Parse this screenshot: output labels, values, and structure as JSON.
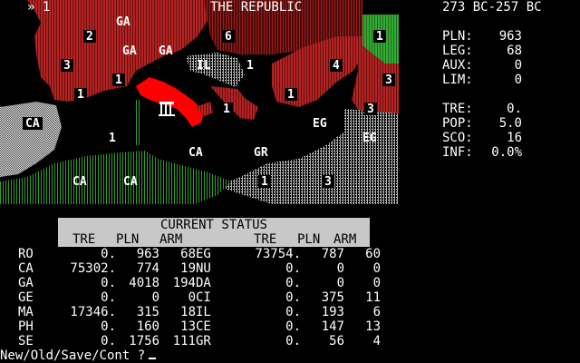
{
  "map": {
    "title": "THE REPUBLIC",
    "corner_label": "» 1",
    "labels": [
      {
        "t": "GA"
      },
      {
        "t": "2"
      },
      {
        "t": "GA"
      },
      {
        "t": "GA"
      },
      {
        "t": "6"
      },
      {
        "t": "1"
      },
      {
        "t": "3"
      },
      {
        "t": "1"
      },
      {
        "t": "IL"
      },
      {
        "t": "1"
      },
      {
        "t": "4"
      },
      {
        "t": "3"
      },
      {
        "t": "1"
      },
      {
        "t": "1"
      },
      {
        "t": "1"
      },
      {
        "t": "CA"
      },
      {
        "t": "EG"
      },
      {
        "t": "3"
      },
      {
        "t": "1"
      },
      {
        "t": "CA"
      },
      {
        "t": "GR"
      },
      {
        "t": "EG"
      },
      {
        "t": "CA"
      },
      {
        "t": "CA"
      },
      {
        "t": "1"
      },
      {
        "t": "3"
      }
    ]
  },
  "header": {
    "years": "273 BC-257 BC"
  },
  "stats": [
    {
      "label": "PLN:",
      "value": "963"
    },
    {
      "label": "LEG:",
      "value": "68"
    },
    {
      "label": "AUX:",
      "value": "0"
    },
    {
      "label": "LIM:",
      "value": "0"
    },
    {
      "label": "",
      "value": ""
    },
    {
      "label": "TRE:",
      "value": "0."
    },
    {
      "label": "POP:",
      "value": "5.0"
    },
    {
      "label": "SCO:",
      "value": "16"
    },
    {
      "label": "INF:",
      "value": "0.0%"
    }
  ],
  "status": {
    "title": "CURRENT STATUS",
    "columns": [
      "TRE",
      "PLN",
      "ARM",
      "TRE",
      "PLN",
      "ARM"
    ],
    "rows": [
      [
        "RO",
        "0.",
        "963",
        "68",
        "EG",
        "73754.",
        "787",
        "60"
      ],
      [
        "CA",
        "75302.",
        "774",
        "19",
        "NU",
        "0.",
        "0",
        "0"
      ],
      [
        "GA",
        "0.",
        "4018",
        "194",
        "DA",
        "0.",
        "0",
        "0"
      ],
      [
        "GE",
        "0.",
        "0",
        "0",
        "CI",
        "0.",
        "375",
        "11"
      ],
      [
        "MA",
        "17346.",
        "315",
        "18",
        "IL",
        "0.",
        "193",
        "6"
      ],
      [
        "PH",
        "0.",
        "160",
        "13",
        "CE",
        "0.",
        "147",
        "13"
      ],
      [
        "SE",
        "0.",
        "1756",
        "111",
        "GR",
        "0.",
        "56",
        "4"
      ]
    ]
  },
  "prompt": "New/Old/Save/Cont ?",
  "colors": {
    "red": "#b42323",
    "brightred": "#ff0000",
    "green": "#2e9e2e",
    "gray": "#a8a8a8",
    "white": "#ffffff"
  }
}
